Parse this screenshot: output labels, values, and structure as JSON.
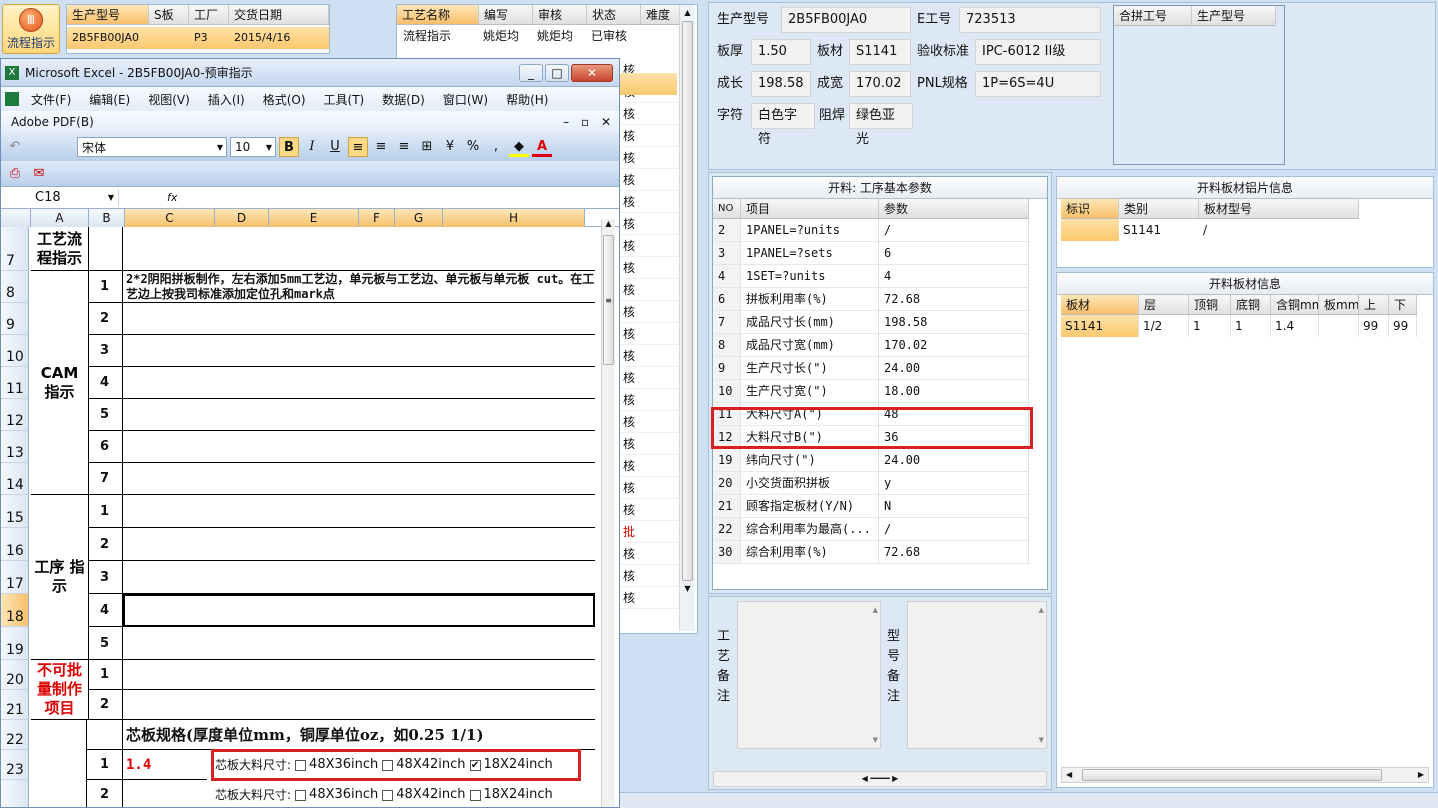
{
  "flow_button": {
    "label": "流程指示"
  },
  "order_grid": {
    "headers": [
      "生产型号",
      "S板",
      "工厂",
      "交货日期"
    ],
    "row": [
      "2B5FB00JA0",
      "",
      "P3",
      "2015/4/16"
    ]
  },
  "process_grid": {
    "headers": [
      "工艺名称",
      "编写",
      "审核",
      "状态",
      "难度"
    ],
    "rows": [
      [
        "流程指示",
        "姚炬均",
        "姚炬均",
        "已审核",
        ""
      ],
      [
        "",
        "",
        "",
        "",
        ""
      ]
    ],
    "partial_status": [
      "核",
      "核",
      "核",
      "核",
      "核",
      "核",
      "核",
      "核",
      "核",
      "核",
      "核",
      "核",
      "核",
      "核",
      "核",
      "核",
      "核",
      "核",
      "核",
      "核",
      "核",
      "批",
      "核",
      "核",
      "核"
    ]
  },
  "excel": {
    "title": "Microsoft Excel - 2B5FB00JA0-预审指示",
    "menu": [
      "文件(F)",
      "编辑(E)",
      "视图(V)",
      "插入(I)",
      "格式(O)",
      "工具(T)",
      "数据(D)",
      "窗口(W)",
      "帮助(H)"
    ],
    "menu2": "Adobe PDF(B)",
    "font_name": "宋体",
    "font_size": "10",
    "name_box": "C18",
    "fx": "fx",
    "columns": [
      "A",
      "B",
      "C",
      "D",
      "E",
      "F",
      "G",
      "H"
    ],
    "rows": [
      {
        "num": "7",
        "a": "工艺流程指示",
        "b": "",
        "c": ""
      },
      {
        "num": "8",
        "a": "",
        "b": "1",
        "c": "2*2阴阳拼板制作，左右添加5mm工艺边，单元板与工艺边、单元板与单元板 cut。在工艺边上按我司标准添加定位孔和mark点"
      },
      {
        "num": "9",
        "a": "",
        "b": "2",
        "c": ""
      },
      {
        "num": "10",
        "a": "",
        "b": "3",
        "c": ""
      },
      {
        "num": "11",
        "a": "CAM 指示",
        "b": "4",
        "c": ""
      },
      {
        "num": "12",
        "a": "",
        "b": "5",
        "c": ""
      },
      {
        "num": "13",
        "a": "",
        "b": "6",
        "c": ""
      },
      {
        "num": "14",
        "a": "",
        "b": "7",
        "c": ""
      },
      {
        "num": "15",
        "a": "",
        "b": "1",
        "c": ""
      },
      {
        "num": "16",
        "a": "",
        "b": "2",
        "c": ""
      },
      {
        "num": "17",
        "a": "工序 指示",
        "b": "3",
        "c": ""
      },
      {
        "num": "18",
        "a": "",
        "b": "4",
        "c": ""
      },
      {
        "num": "19",
        "a": "",
        "b": "5",
        "c": ""
      },
      {
        "num": "20",
        "a": "不可批 量制作",
        "b": "1",
        "c": ""
      },
      {
        "num": "21",
        "a": "项目",
        "b": "2",
        "c": ""
      },
      {
        "num": "22",
        "a": "",
        "b": "",
        "c": "芯板规格(厚度单位mm，铜厚单位oz，如0.25 1/1)"
      },
      {
        "num": "23",
        "a": "",
        "b": "1",
        "c": "1.4"
      },
      {
        "num": "",
        "a": "",
        "b": "2",
        "c": ""
      }
    ],
    "core_label": "芯板大料尺寸:",
    "core_opts": [
      "48X36inch",
      "48X42inch",
      "18X24inch"
    ],
    "core_checked_row1": [
      false,
      false,
      true
    ],
    "core_checked_row2": [
      false,
      false,
      false
    ]
  },
  "info": {
    "prod_model_label": "生产型号",
    "prod_model": "2B5FB00JA0",
    "e_no_label": "E工号",
    "e_no": "723513",
    "thickness_label": "板厚",
    "thickness": "1.50",
    "material_label": "板材",
    "material": "S1141",
    "standard_label": "验收标准",
    "standard": "IPC-6012 II级",
    "length_label": "成长",
    "length": "198.58",
    "width_label": "成宽",
    "width": "170.02",
    "pnl_label": "PNL规格",
    "pnl": "1P=6S=4U",
    "char_label": "字符",
    "char": "白色字符",
    "mask_label": "阻焊",
    "mask": "绿色亚光",
    "merge_headers": [
      "合拼工号",
      "生产型号"
    ]
  },
  "params": {
    "title": "开料: 工序基本参数",
    "headers": [
      "NO",
      "项目",
      "参数"
    ],
    "rows": [
      [
        "2",
        "1PANEL=?units",
        "/"
      ],
      [
        "3",
        "1PANEL=?sets",
        "6"
      ],
      [
        "4",
        "1SET=?units",
        "4"
      ],
      [
        "6",
        "拼板利用率(%)",
        "72.68"
      ],
      [
        "7",
        "成品尺寸长(mm)",
        "198.58"
      ],
      [
        "8",
        "成品尺寸宽(mm)",
        "170.02"
      ],
      [
        "9",
        "生产尺寸长(\")",
        "24.00"
      ],
      [
        "10",
        "生产尺寸宽(\")",
        "18.00"
      ],
      [
        "11",
        "大料尺寸A(\")",
        "48"
      ],
      [
        "12",
        "大料尺寸B(\")",
        "36"
      ],
      [
        "19",
        "纬向尺寸(\")",
        "24.00"
      ],
      [
        "20",
        "小交货面积拼板",
        "y"
      ],
      [
        "21",
        "顾客指定板材(Y/N)",
        "N"
      ],
      [
        "22",
        "综合利用率为最高(...",
        "/"
      ],
      [
        "30",
        "综合利用率(%)",
        "72.68"
      ]
    ]
  },
  "foil": {
    "title": "开料板材铝片信息",
    "headers": [
      "标识",
      "类别",
      "板材型号"
    ],
    "row": [
      "",
      "S1141",
      "/"
    ]
  },
  "sheet": {
    "title": "开料板材信息",
    "headers": [
      "板材",
      "层",
      "顶铜",
      "底铜",
      "含铜mm",
      "板mm",
      "上",
      "下"
    ],
    "row": [
      "S1141",
      "1/2",
      "1",
      "1",
      "1.4",
      "",
      "99",
      "99"
    ]
  },
  "remarks": {
    "process": "工艺备注",
    "model": "型号备注"
  }
}
